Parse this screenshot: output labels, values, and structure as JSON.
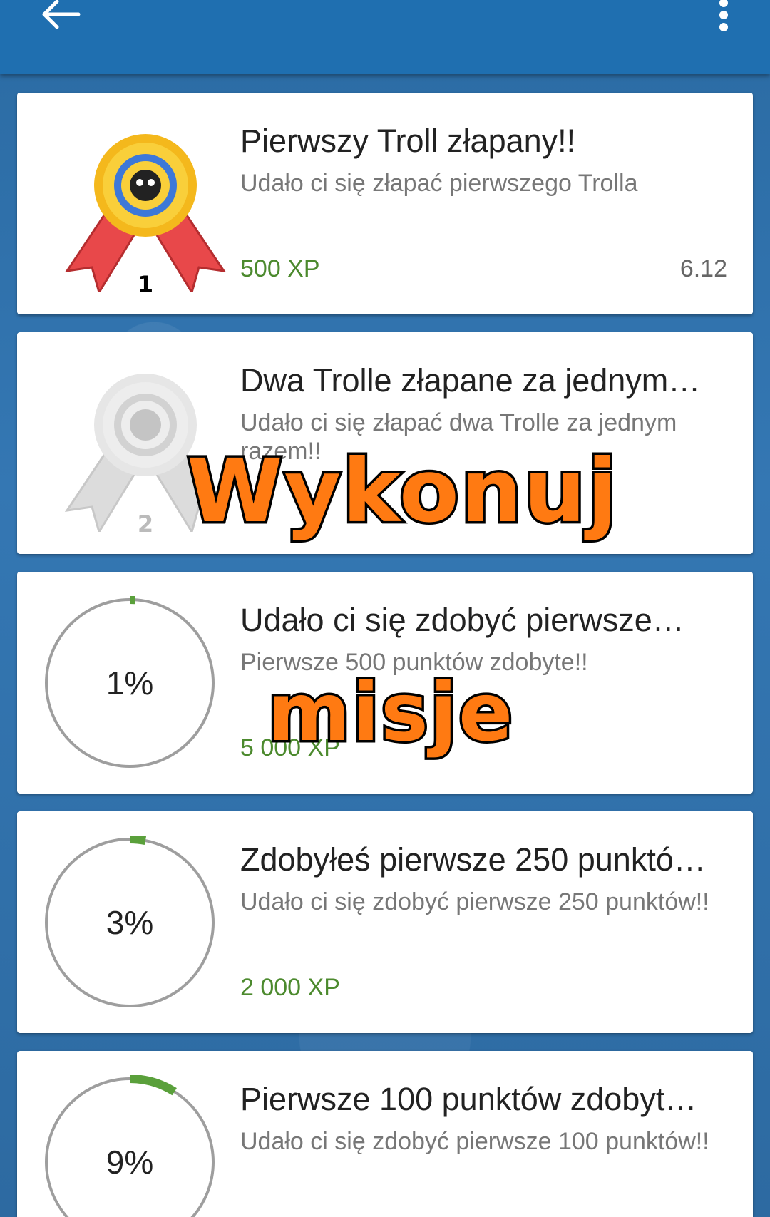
{
  "colors": {
    "appbar": "#1f6fb0",
    "xp_green": "#4c8a2e",
    "progress_green": "#5aa03b",
    "overlay_orange": "#ff7a12"
  },
  "icons": {
    "back": "arrow-left-icon",
    "more": "more-vert-icon",
    "badge": "ribbon-medal-icon"
  },
  "achievements": [
    {
      "title": "Pierwszy Troll złapany!!",
      "description": "Udało ci się złapać pierwszego Trolla",
      "xp": "500 XP",
      "date": "6.12",
      "badge_number": "1",
      "unlocked": true
    },
    {
      "title": "Dwa Trolle złapane za jednym…",
      "description": "Udało ci się złapać dwa Trolle za jednym razem!!",
      "xp": "",
      "badge_number": "2",
      "unlocked": false
    },
    {
      "title": "Udało ci się zdobyć pierwsze…",
      "description": "Pierwsze 500 punktów zdobyte!!",
      "xp": "5 000 XP",
      "progress_label": "1%",
      "progress": 0.01
    },
    {
      "title": "Zdobyłeś pierwsze 250 punktó…",
      "description": "Udało ci się zdobyć pierwsze 250 punktów!!",
      "xp": "2 000 XP",
      "progress_label": "3%",
      "progress": 0.03
    },
    {
      "title": "Pierwsze 100 punktów zdobyt…",
      "description": "Udało ci się zdobyć pierwsze 100 punktów!!",
      "progress_label": "9%",
      "progress": 0.09
    }
  ],
  "overlay": {
    "line1": "Wykonuj",
    "line2": "misje"
  }
}
